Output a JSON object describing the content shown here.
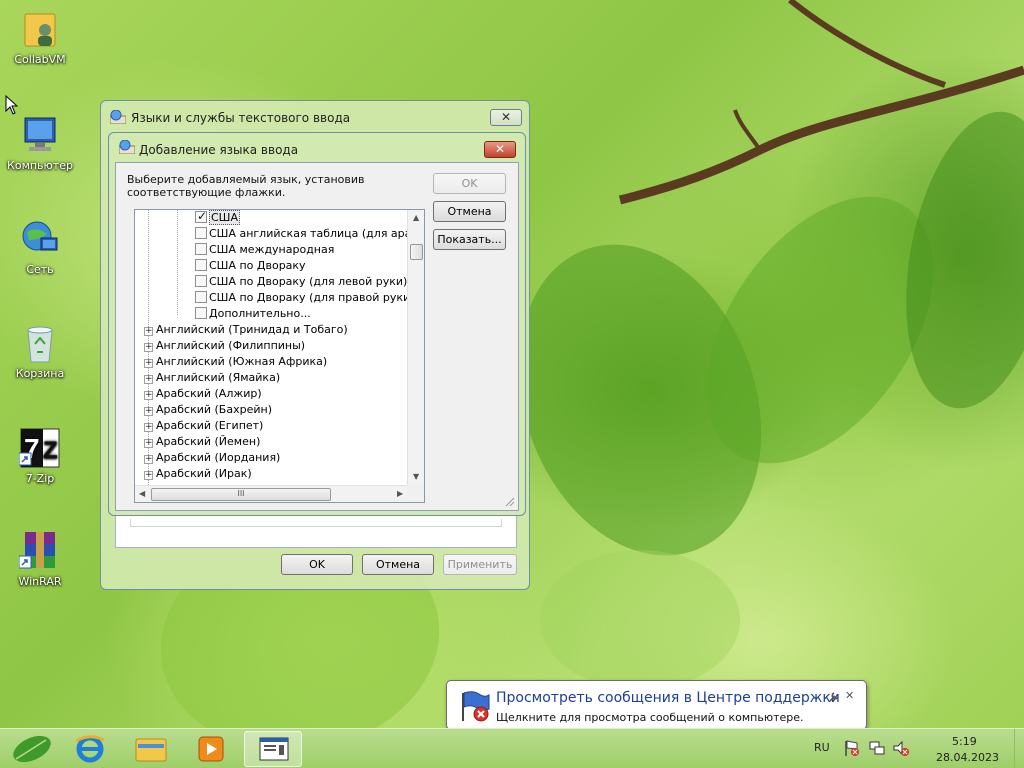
{
  "desktop": {
    "icons": [
      {
        "label": "CollabVM"
      },
      {
        "label": "Компьютер"
      },
      {
        "label": "Сеть"
      },
      {
        "label": "Корзина"
      },
      {
        "label": "7-Zip"
      },
      {
        "label": "WinRAR"
      }
    ]
  },
  "outer_window": {
    "title": "Языки и службы текстового ввода",
    "close_glyph": "✕",
    "ok_label": "OK",
    "cancel_label": "Отмена",
    "apply_label": "Применить"
  },
  "inner_window": {
    "title": "Добавление языка ввода",
    "close_glyph": "✕",
    "instruction": "Выберите добавляемый язык, установив соответствующие флажки.",
    "ok_label": "OK",
    "cancel_label": "Отмена",
    "show_label": "Показать...",
    "layout_items": [
      {
        "label": "США",
        "checked": true
      },
      {
        "label": "США английская таблица (для арабских",
        "checked": false
      },
      {
        "label": "США международная",
        "checked": false
      },
      {
        "label": "США по Двораку",
        "checked": false
      },
      {
        "label": "США по Двораку (для левой руки)",
        "checked": false
      },
      {
        "label": "США по Двораку (для правой руки)",
        "checked": false
      },
      {
        "label": "Дополнительно...",
        "checked": false
      }
    ],
    "language_items": [
      {
        "label": "Английский (Тринидад и Тобаго)"
      },
      {
        "label": "Английский (Филиппины)"
      },
      {
        "label": "Английский (Южная Африка)"
      },
      {
        "label": "Английский (Ямайка)"
      },
      {
        "label": "Арабский (Алжир)"
      },
      {
        "label": "Арабский (Бахрейн)"
      },
      {
        "label": "Арабский (Египет)"
      },
      {
        "label": "Арабский (Йемен)"
      },
      {
        "label": "Арабский (Иордания)"
      },
      {
        "label": "Арабский (Ирак)"
      }
    ],
    "scroll_thumb_glyph": "III"
  },
  "balloon": {
    "title": "Просмотреть сообщения в Центре поддержки",
    "text": "Щелкните для просмотра сообщений о компьютере.",
    "close_glyph": "✕"
  },
  "taskbar": {
    "language": "RU",
    "time": "5:19",
    "date": "28.04.2023"
  },
  "colors": {
    "balloon_title": "#1c3f94",
    "close_red": "#c2422c",
    "taskbar": "#a8d479"
  }
}
